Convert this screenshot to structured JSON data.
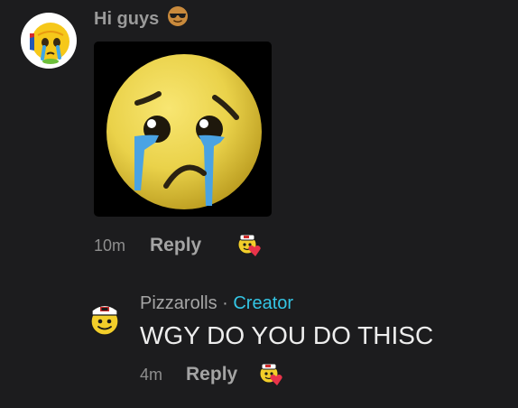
{
  "comment": {
    "author_avatar_icon": "crying-emoji-avatar-icon",
    "text": "Hi guys",
    "text_emoji_icon": "sunglasses-face-icon",
    "attachment_icon": "crying-face-emoji-icon",
    "time": "10m",
    "reply_label": "Reply",
    "reaction_icon": "creator-heart-reaction-icon"
  },
  "reply": {
    "avatar_icon": "sailor-hat-smiley-avatar-icon",
    "author": "Pizzarolls",
    "separator": "·",
    "badge": "Creator",
    "text": "WGY DO YOU DO THISC",
    "time": "4m",
    "reply_label": "Reply",
    "reaction_icon": "creator-heart-reaction-icon"
  },
  "colors": {
    "background": "#1c1c1e",
    "creator_badge": "#34c6e5",
    "muted_text": "#9a9a9a",
    "heart": "#e8334a"
  }
}
